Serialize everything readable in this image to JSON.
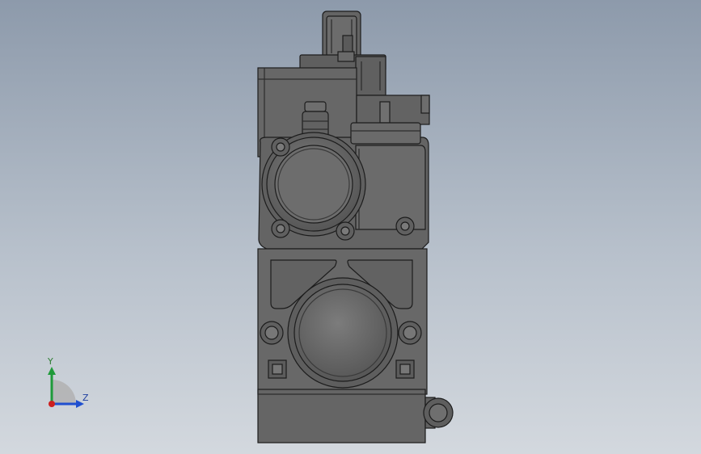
{
  "triad": {
    "y_label": "Y",
    "z_label": "Z",
    "colors": {
      "y_axis": "#1f9a3a",
      "z_axis": "#1f4fd0",
      "x_axis": "#cc1f1f"
    }
  },
  "background": {
    "top": "#8d9aab",
    "bottom": "#d3d8de"
  }
}
